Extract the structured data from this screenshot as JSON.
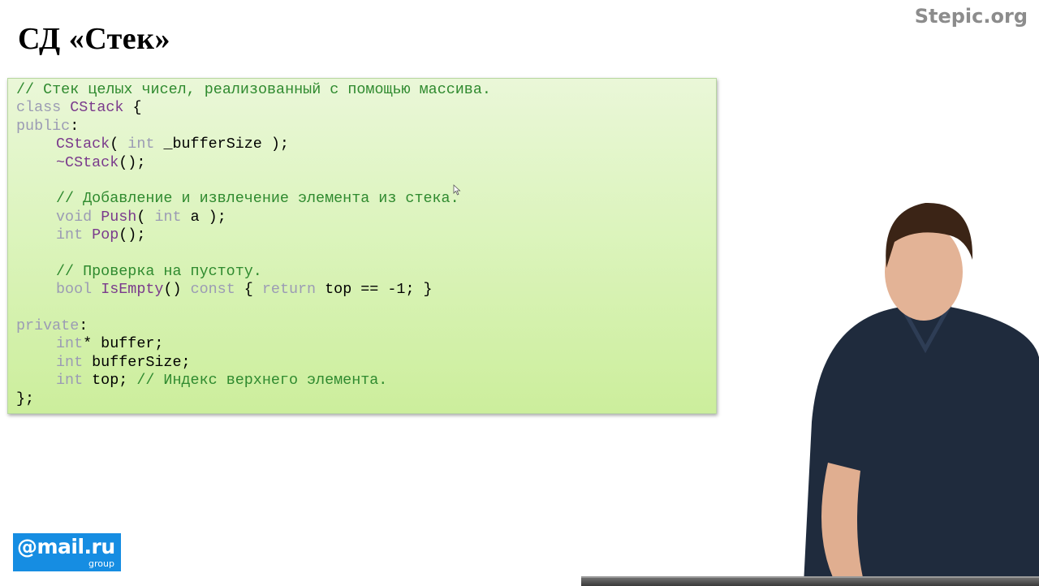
{
  "slide": {
    "title": "СД «Стек»",
    "watermark": "Stepic.org"
  },
  "code": {
    "comment_header": "// Стек целых чисел, реализованный с помощью массива.",
    "kw_class": "class",
    "class_name": "CStack",
    "brace_open": " {",
    "kw_public": "public",
    "colon": ":",
    "ctor_name": "CStack",
    "ctor_open": "( ",
    "kw_int": "int",
    "ctor_param": " _bufferSize );",
    "dtor": "~CStack",
    "call_end": "();",
    "comment_push_pop": "// Добавление и извлечение элемента из стека.",
    "kw_void": "void",
    "push_name": "Push",
    "push_open": "( ",
    "push_param": " a );",
    "pop_name": "Pop",
    "comment_empty": "// Проверка на пустоту.",
    "kw_bool": "bool",
    "isempty_name": "IsEmpty",
    "isempty_parens": "() ",
    "kw_const": "const",
    "brace_space": " { ",
    "kw_return": "return",
    "return_expr": " top == -1; }",
    "kw_private": "private",
    "member_buffer": "* buffer;",
    "member_buffersize": " bufferSize;",
    "member_top": " top; ",
    "comment_top": "// Индекс верхнего элемента.",
    "class_end": "};"
  },
  "logo": {
    "main": "@mail.ru",
    "sub": "group"
  },
  "colors": {
    "panel_bg": "#dcf4bd",
    "comment": "#2f8a2f",
    "keyword": "#9b9bb4",
    "function": "#7a3a8c",
    "logo_bg": "#168de2"
  }
}
